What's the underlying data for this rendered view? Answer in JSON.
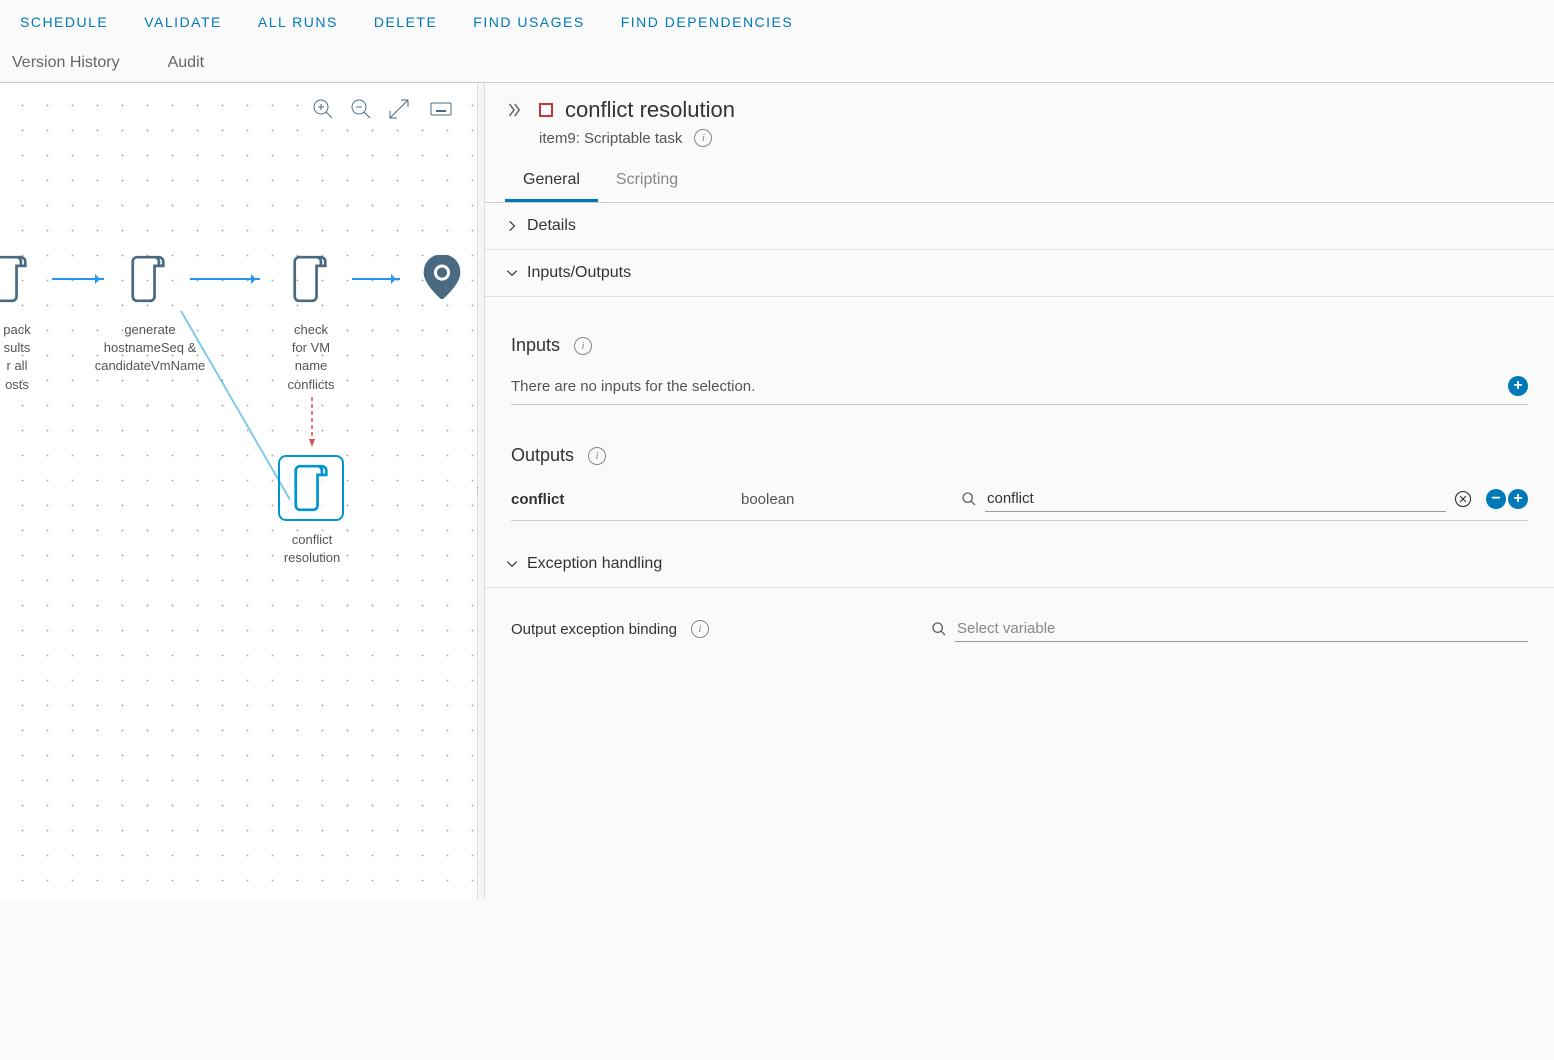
{
  "toolbar": {
    "schedule": "SCHEDULE",
    "validate": "VALIDATE",
    "all_runs": "ALL RUNS",
    "delete": "DELETE",
    "find_usages": "FIND USAGES",
    "find_dependencies": "FIND DEPENDENCIES"
  },
  "subtabs": {
    "version_history": "Version History",
    "audit": "Audit"
  },
  "canvas": {
    "nodes": {
      "pack": "pack\nsults\nr all\nosts",
      "generate": "generate\nhostnameSeq &\ncandidateVmName",
      "check": "check\nfor VM\nname\nconflicts",
      "conflict": "conflict\nresolution"
    }
  },
  "panel": {
    "title": "conflict resolution",
    "subtitle": "item9: Scriptable task",
    "tabs": {
      "general": "General",
      "scripting": "Scripting"
    },
    "sections": {
      "details": "Details",
      "inputs_outputs": "Inputs/Outputs",
      "exception": "Exception handling"
    },
    "inputs": {
      "label": "Inputs",
      "empty": "There are no inputs for the selection."
    },
    "outputs": {
      "label": "Outputs",
      "row": {
        "name": "conflict",
        "type": "boolean",
        "value": "conflict"
      }
    },
    "exception_body": {
      "label": "Output exception binding",
      "placeholder": "Select variable"
    }
  }
}
